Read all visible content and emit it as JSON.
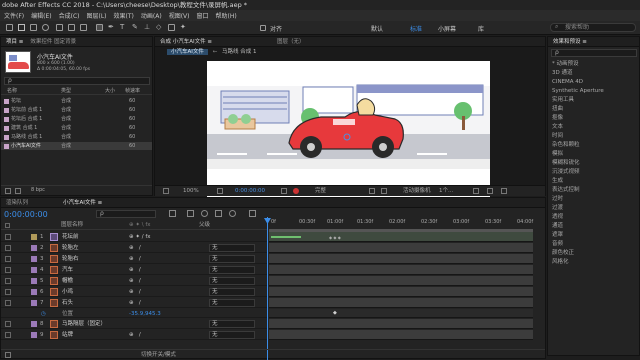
{
  "window": {
    "title": "dobe After Effects CC 2018 - C:\\Users\\cheese\\Desktop\\教程文件\\录屏帆.aep *"
  },
  "menu": [
    "文件(F)",
    "编辑(E)",
    "合成(C)",
    "图层(L)",
    "效果(T)",
    "动画(A)",
    "视图(V)",
    "窗口",
    "帮助(H)"
  ],
  "toolbar": {
    "align_label": "对齐",
    "workspaces": [
      "默认",
      "标准",
      "小屏幕",
      "库"
    ],
    "active_workspace": "标准",
    "search_placeholder": "搜索帮助"
  },
  "project_panel": {
    "tabs": [
      "项目 ≡",
      "效果控件 固定背景"
    ],
    "selected_name": "小汽车AI文件",
    "dims": "800 x 600 (1.00)",
    "duration": "Δ 0:00:04:05, 60.00 fps",
    "search_placeholder": "ρ",
    "col_name": "名称",
    "col_type": "类型",
    "col_size": "大小",
    "col_rate": "帧速率",
    "items": [
      {
        "name": "花坛",
        "type": "合成",
        "rate": "60"
      },
      {
        "name": "花坛前 合成 1",
        "type": "合成",
        "rate": "60"
      },
      {
        "name": "花坛后 合成 1",
        "type": "合成",
        "rate": "60"
      },
      {
        "name": "建筑 合成 1",
        "type": "合成",
        "rate": "60"
      },
      {
        "name": "马路线 合成 1",
        "type": "合成",
        "rate": "60"
      },
      {
        "name": "小汽车AI文件",
        "type": "合成",
        "rate": "60"
      }
    ],
    "bpc": "8 bpc"
  },
  "comp_panel": {
    "tab_label": "合成 小汽车AI文件 ≡",
    "layer_tab": "图层（无）",
    "breadcrumbs": [
      "小汽车AI文件",
      "马路线 合成 1"
    ],
    "zoom": "100%",
    "time": "0:00:00:00",
    "resolution": "完整",
    "camera": "活动摄像机",
    "views": "1个..."
  },
  "timeline": {
    "tabs": [
      "渲染队列",
      "小汽车AI文件 ≡"
    ],
    "current_time": "0:00:00:00",
    "search_placeholder": "ρ",
    "col_source": "图层名称",
    "col_mode": "模式",
    "col_parent": "父级",
    "ruler": [
      "0f",
      "00:30f",
      "01:00f",
      "01:30f",
      "02:00f",
      "02:30f",
      "03:00f",
      "03:30f",
      "04:00f"
    ],
    "layers": [
      {
        "num": "1",
        "name": "花坛前",
        "mode": "",
        "parent": "",
        "color": "#b09a5a"
      },
      {
        "num": "2",
        "name": "轮胎左",
        "mode": "",
        "parent": "无",
        "color": "#9b7ab8"
      },
      {
        "num": "3",
        "name": "轮胎右",
        "mode": "",
        "parent": "无",
        "color": "#9b7ab8"
      },
      {
        "num": "4",
        "name": "汽车",
        "mode": "",
        "parent": "无",
        "color": "#9b7ab8"
      },
      {
        "num": "5",
        "name": "帽檐",
        "mode": "",
        "parent": "无",
        "color": "#9b7ab8"
      },
      {
        "num": "6",
        "name": "小鸡",
        "mode": "",
        "parent": "无",
        "color": "#9b7ab8"
      },
      {
        "num": "7",
        "name": "石头",
        "mode": "",
        "parent": "无",
        "color": "#9b7ab8"
      },
      {
        "num": "8",
        "name": "马路隔层（固定）",
        "mode": "",
        "parent": "无",
        "color": "#9b7ab8"
      },
      {
        "num": "9",
        "name": "站牌",
        "mode": "",
        "parent": "无",
        "color": "#9b7ab8"
      }
    ],
    "position_label": "位置",
    "position_value": "-35.9,945.3",
    "switch_label": "切换开关/模式"
  },
  "effects_panel": {
    "tab_label": "效果和预设 ≡",
    "search_placeholder": "ρ",
    "items": [
      "* 动画预设",
      "3D 通道",
      "CINEMA 4D",
      "Synthetic Aperture",
      "实用工具",
      "扭曲",
      "抠像",
      "文本",
      "时间",
      "杂色和颗粒",
      "模拟",
      "模糊和锐化",
      "沉浸式视频",
      "生成",
      "表达式控制",
      "过时",
      "过渡",
      "透视",
      "通道",
      "遮罩",
      "音频",
      "颜色校正",
      "风格化"
    ]
  }
}
